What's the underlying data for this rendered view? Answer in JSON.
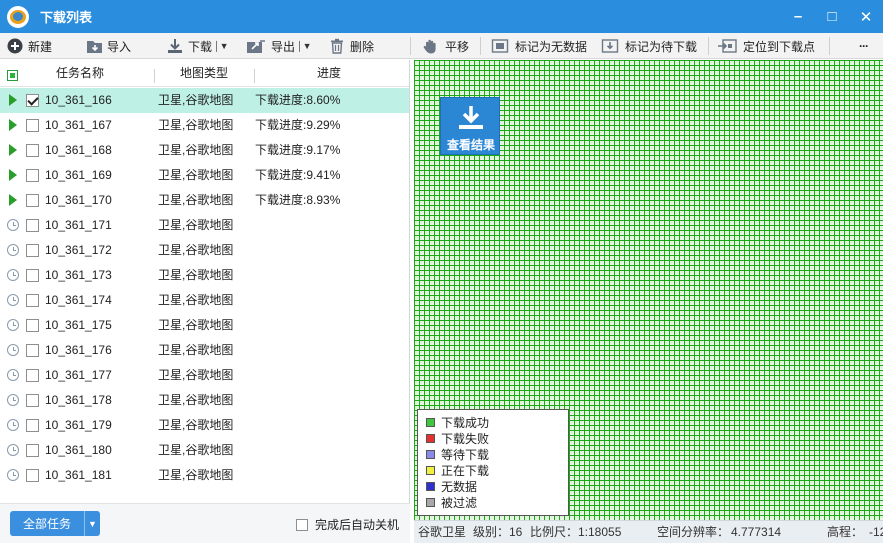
{
  "window": {
    "title": "下载列表",
    "minimize_glyph": "–",
    "maximize_glyph": "□",
    "close_glyph": "✕"
  },
  "toolbar": {
    "new_label": "新建",
    "import_label": "导入",
    "download_label": "下载",
    "export_label": "导出",
    "delete_label": "删除",
    "pan_label": "平移",
    "mark_no_data_label": "标记为无数据",
    "mark_pending_label": "标记为待下载",
    "locate_label": "定位到下载点",
    "more_label": "···"
  },
  "task_list": {
    "columns": [
      "任务名称",
      "地图类型",
      "进度"
    ],
    "rows": [
      {
        "status": "running",
        "checked": true,
        "name": "10_361_166",
        "map_type": "卫星,谷歌地图",
        "progress": "下载进度:8.60%"
      },
      {
        "status": "running",
        "checked": false,
        "name": "10_361_167",
        "map_type": "卫星,谷歌地图",
        "progress": "下载进度:9.29%"
      },
      {
        "status": "running",
        "checked": false,
        "name": "10_361_168",
        "map_type": "卫星,谷歌地图",
        "progress": "下载进度:9.17%"
      },
      {
        "status": "running",
        "checked": false,
        "name": "10_361_169",
        "map_type": "卫星,谷歌地图",
        "progress": "下载进度:9.41%"
      },
      {
        "status": "running",
        "checked": false,
        "name": "10_361_170",
        "map_type": "卫星,谷歌地图",
        "progress": "下载进度:8.93%"
      },
      {
        "status": "waiting",
        "checked": false,
        "name": "10_361_171",
        "map_type": "卫星,谷歌地图",
        "progress": ""
      },
      {
        "status": "waiting",
        "checked": false,
        "name": "10_361_172",
        "map_type": "卫星,谷歌地图",
        "progress": ""
      },
      {
        "status": "waiting",
        "checked": false,
        "name": "10_361_173",
        "map_type": "卫星,谷歌地图",
        "progress": ""
      },
      {
        "status": "waiting",
        "checked": false,
        "name": "10_361_174",
        "map_type": "卫星,谷歌地图",
        "progress": ""
      },
      {
        "status": "waiting",
        "checked": false,
        "name": "10_361_175",
        "map_type": "卫星,谷歌地图",
        "progress": ""
      },
      {
        "status": "waiting",
        "checked": false,
        "name": "10_361_176",
        "map_type": "卫星,谷歌地图",
        "progress": ""
      },
      {
        "status": "waiting",
        "checked": false,
        "name": "10_361_177",
        "map_type": "卫星,谷歌地图",
        "progress": ""
      },
      {
        "status": "waiting",
        "checked": false,
        "name": "10_361_178",
        "map_type": "卫星,谷歌地图",
        "progress": ""
      },
      {
        "status": "waiting",
        "checked": false,
        "name": "10_361_179",
        "map_type": "卫星,谷歌地图",
        "progress": ""
      },
      {
        "status": "waiting",
        "checked": false,
        "name": "10_361_180",
        "map_type": "卫星,谷歌地图",
        "progress": ""
      },
      {
        "status": "waiting",
        "checked": false,
        "name": "10_361_181",
        "map_type": "卫星,谷歌地图",
        "progress": ""
      }
    ]
  },
  "footer": {
    "all_tasks_label": "全部任务",
    "auto_shutdown_label": "完成后自动关机"
  },
  "map": {
    "view_result_label": "查看结果",
    "legend": [
      {
        "label": "下载成功",
        "color": "#3ec63e"
      },
      {
        "label": "下载失败",
        "color": "#e53030"
      },
      {
        "label": "等待下载",
        "color": "#8a8ae8"
      },
      {
        "label": "正在下载",
        "color": "#f0f040"
      },
      {
        "label": "无数据",
        "color": "#3030d0"
      },
      {
        "label": "被过滤",
        "color": "#a8a8a8"
      }
    ],
    "tile_color": "#22c11a"
  },
  "statusbar": {
    "source": "谷歌卫星",
    "level_label": "级别：",
    "level_value": "16",
    "scale_label": "比例尺：",
    "scale_value": "1:18055",
    "resolution_label": "空间分辨率：",
    "resolution_value": "4.777314",
    "elevation_label": "高程：",
    "elevation_value": "-12"
  }
}
